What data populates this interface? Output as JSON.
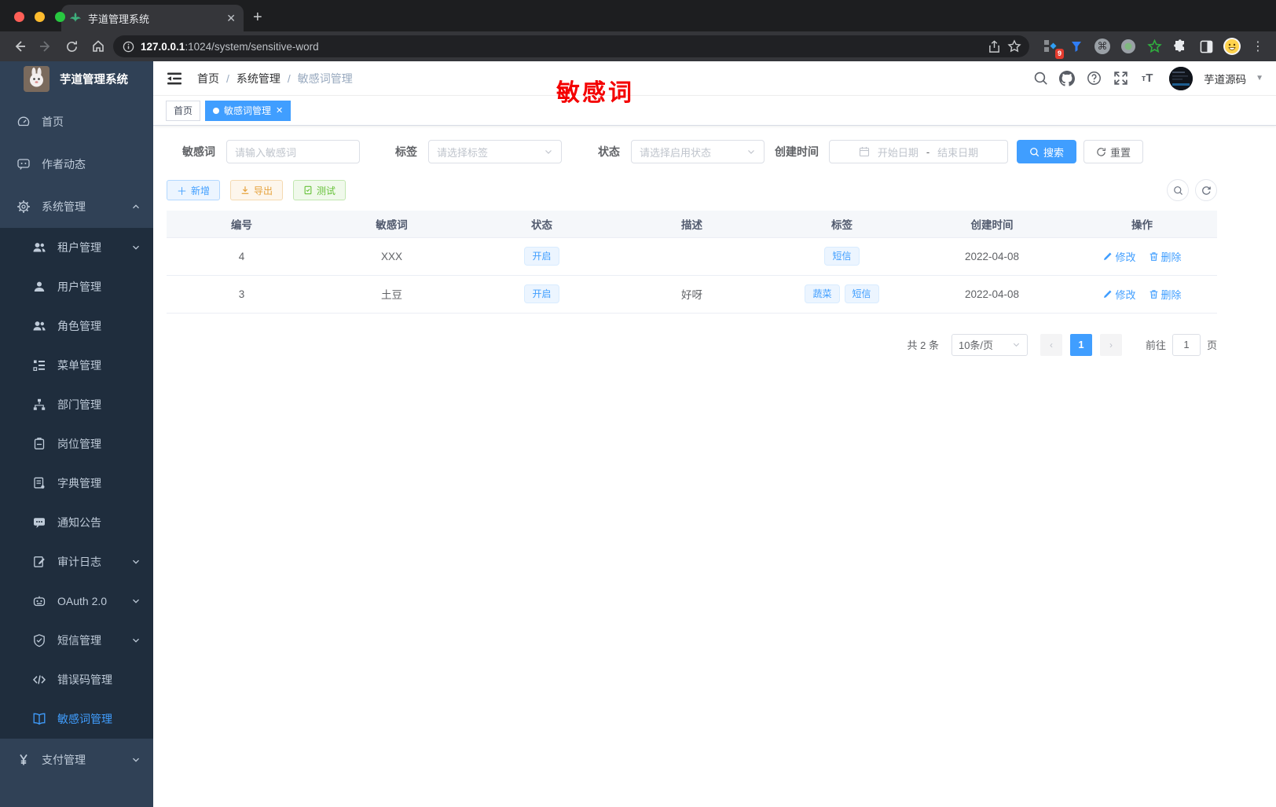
{
  "colors": {
    "accent": "#409eff",
    "warning": "#e6a23c",
    "success": "#67c23a",
    "annotation_red": "#f40000",
    "sidebar_bg": "#304156",
    "submenu_bg": "#1f2d3d",
    "active_tag_bg": "#409eff"
  },
  "browser": {
    "tab_title": "芋道管理系统",
    "favicon": "leaf-icon",
    "url_host": "127.0.0.1",
    "url_rest": ":1024/system/sensitive-word",
    "extension_badge": "9"
  },
  "sidebar": {
    "logo_title": "芋道管理系统",
    "items": [
      {
        "label": "首页",
        "icon": "dashboard-icon",
        "level": "top"
      },
      {
        "label": "作者动态",
        "icon": "chat-icon",
        "level": "top"
      },
      {
        "label": "系统管理",
        "icon": "gear-icon",
        "level": "top",
        "arrow": "up"
      },
      {
        "label": "租户管理",
        "icon": "tenant-users-icon",
        "level": "sub",
        "arrow": "down"
      },
      {
        "label": "用户管理",
        "icon": "user-icon",
        "level": "sub"
      },
      {
        "label": "角色管理",
        "icon": "role-users-icon",
        "level": "sub"
      },
      {
        "label": "菜单管理",
        "icon": "menu-tree-icon",
        "level": "sub"
      },
      {
        "label": "部门管理",
        "icon": "org-tree-icon",
        "level": "sub"
      },
      {
        "label": "岗位管理",
        "icon": "post-badge-icon",
        "level": "sub"
      },
      {
        "label": "字典管理",
        "icon": "dict-book-icon",
        "level": "sub"
      },
      {
        "label": "通知公告",
        "icon": "notice-comment-icon",
        "level": "sub"
      },
      {
        "label": "审计日志",
        "icon": "audit-log-icon",
        "level": "sub",
        "arrow": "down"
      },
      {
        "label": "OAuth 2.0",
        "icon": "oauth-robot-icon",
        "level": "sub",
        "arrow": "down"
      },
      {
        "label": "短信管理",
        "icon": "sms-shield-icon",
        "level": "sub",
        "arrow": "down"
      },
      {
        "label": "错误码管理",
        "icon": "errorcode-icon",
        "level": "sub"
      },
      {
        "label": "敏感词管理",
        "icon": "sensitive-word-book-icon",
        "level": "sub",
        "active": true
      },
      {
        "label": "支付管理",
        "icon": "pay-yen-icon",
        "level": "top",
        "arrow": "down"
      }
    ]
  },
  "header": {
    "breadcrumb": [
      "首页",
      "系统管理",
      "敏感词管理"
    ],
    "separator": "/",
    "username": "芋道源码"
  },
  "annotation": {
    "text": "敏感词"
  },
  "tags_view": [
    {
      "label": "首页",
      "active": false,
      "closable": false
    },
    {
      "label": "敏感词管理",
      "active": true,
      "closable": true
    }
  ],
  "filters": {
    "keyword": {
      "label": "敏感词",
      "placeholder": "请输入敏感词"
    },
    "tag": {
      "label": "标签",
      "placeholder": "请选择标签"
    },
    "status": {
      "label": "状态",
      "placeholder": "请选择启用状态"
    },
    "create_time": {
      "label": "创建时间",
      "start_placeholder": "开始日期",
      "separator": "-",
      "end_placeholder": "结束日期"
    },
    "search_label": "搜索",
    "reset_label": "重置"
  },
  "toolbar": {
    "add_label": "新增",
    "export_label": "导出",
    "test_label": "测试"
  },
  "table": {
    "columns": [
      "编号",
      "敏感词",
      "状态",
      "描述",
      "标签",
      "创建时间",
      "操作"
    ],
    "edit_label": "修改",
    "delete_label": "删除",
    "rows": [
      {
        "id": "4",
        "word": "XXX",
        "status": "开启",
        "description": "",
        "tags": [
          "短信"
        ],
        "create_time": "2022-04-08"
      },
      {
        "id": "3",
        "word": "土豆",
        "status": "开启",
        "description": "好呀",
        "tags": [
          "蔬菜",
          "短信"
        ],
        "create_time": "2022-04-08"
      }
    ]
  },
  "pagination": {
    "total_text": "共 2 条",
    "page_size": "10条/页",
    "prev": "‹",
    "next": "›",
    "current_page": "1",
    "goto_label": "前往",
    "goto_value": "1",
    "page_unit": "页"
  }
}
